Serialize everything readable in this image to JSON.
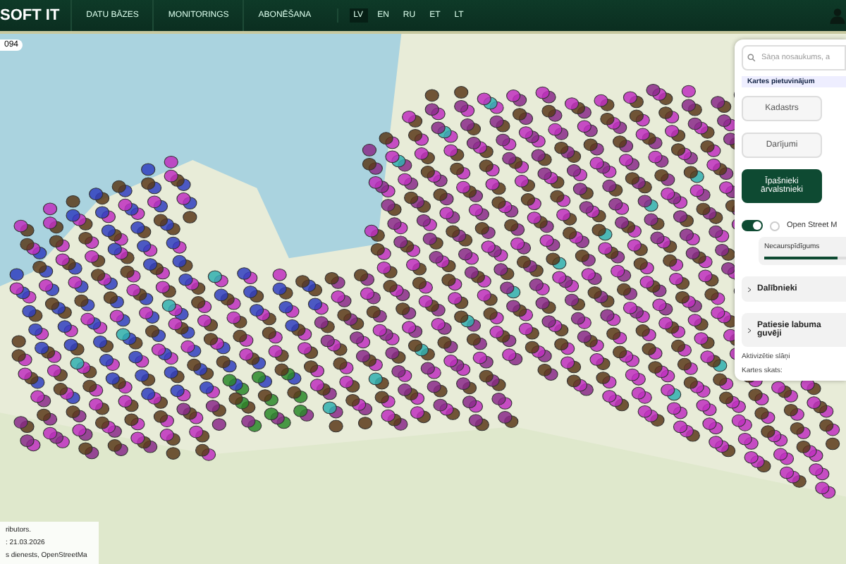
{
  "header": {
    "logo": "SOFT IT",
    "nav": [
      "DATU BĀZES",
      "MONITORINGS",
      "ABONĒŠANA"
    ],
    "languages": [
      {
        "label": "LV",
        "selected": true
      },
      {
        "label": "EN",
        "selected": false
      },
      {
        "label": "RU",
        "selected": false
      },
      {
        "label": "ET",
        "selected": false
      },
      {
        "label": "LT",
        "selected": false
      }
    ]
  },
  "map": {
    "count_badge": "094",
    "attribution": [
      "ributors.",
      ": 21.03.2026",
      "s dienests, OpenStreetMa"
    ]
  },
  "panel": {
    "search": {
      "placeholder": "Sāņa nosaukums, a"
    },
    "zoom_hint": "Kartes pietuvinājum",
    "layers": [
      {
        "label": "Kadastrs",
        "selected": false
      },
      {
        "label": "Darījumi",
        "selected": false
      },
      {
        "label": "Īpašnieki ārvalstnieki",
        "selected": true
      }
    ],
    "basemap": {
      "label": "Open Street M",
      "on": true,
      "radio_selected": false
    },
    "opacity": {
      "label": "Necaurspīdīgums",
      "level": 0.9
    },
    "sections": [
      {
        "label": "Dalībnieki",
        "expanded": false
      },
      {
        "label": "Patiesie labuma guvēji",
        "expanded": false
      }
    ],
    "footer": [
      "Aktivizētie slāņi",
      "Kartes skats:"
    ]
  }
}
